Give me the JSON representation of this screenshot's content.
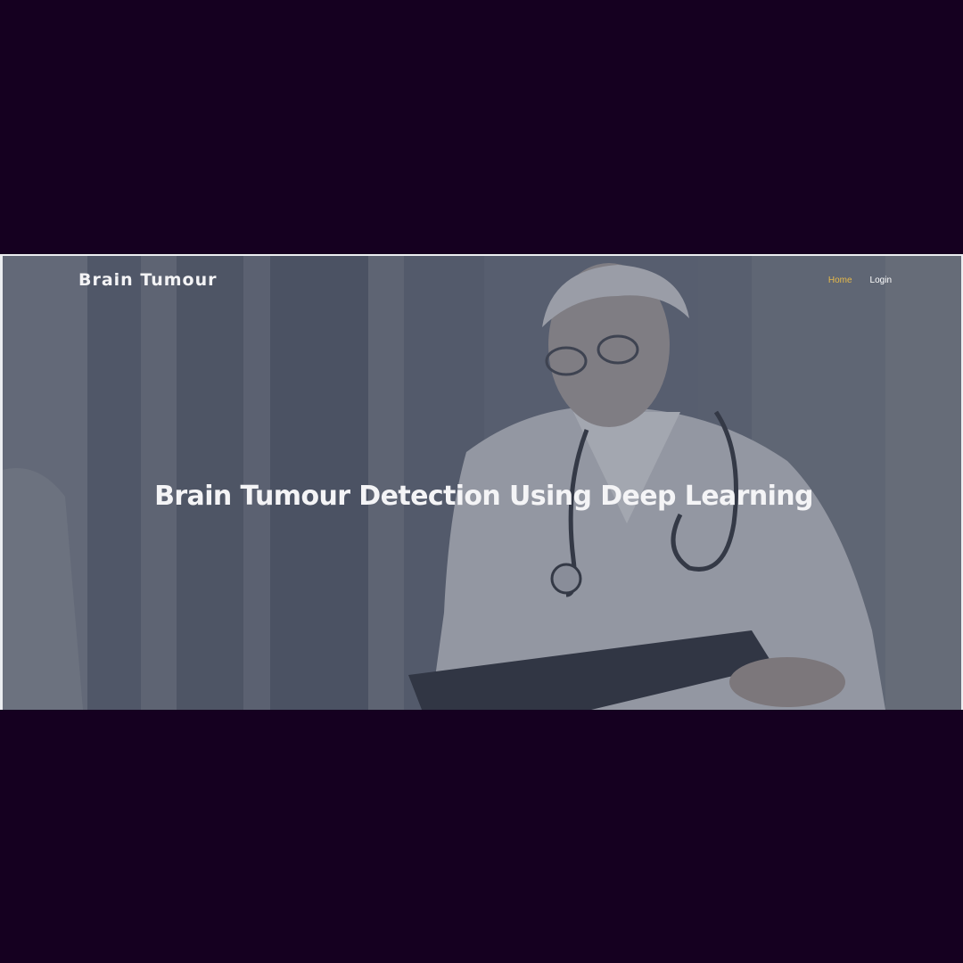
{
  "page": {
    "background_color": "#150020"
  },
  "navbar": {
    "brand": "Brain Tumour",
    "links": [
      {
        "label": "Home",
        "active": true,
        "color": "#e6b94a"
      },
      {
        "label": "Login",
        "active": false,
        "color": "#ffffff"
      }
    ]
  },
  "hero": {
    "headline": "Brain Tumour Detection Using Deep Learning",
    "background_image": "doctor-photo"
  }
}
